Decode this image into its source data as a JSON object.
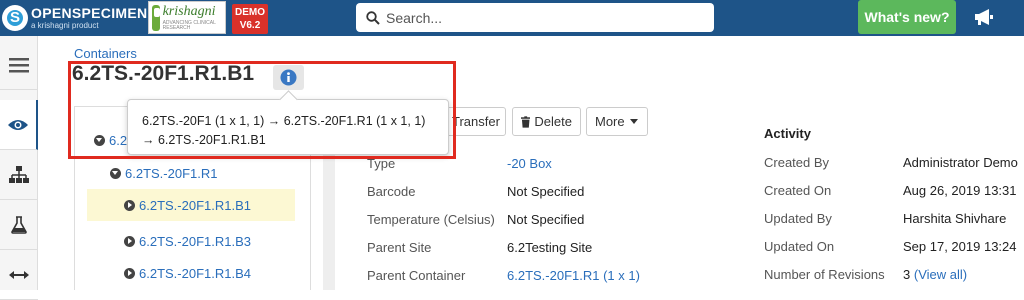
{
  "app": {
    "logo_name": "OPENSPECIMEN",
    "logo_sub": "a krishagni product",
    "brand_name": "krishagni",
    "brand_tag": "ADVANCING CLINICAL RESEARCH",
    "demo_label": "DEMO",
    "version": "V6.2",
    "search_placeholder": "Search...",
    "whats_new": "What's new?"
  },
  "colors": {
    "topbar": "#1e5488",
    "accent_link": "#2a6ebb",
    "whats_new": "#5cb85c",
    "highlight": "#e02a1f",
    "selected_row": "#fcf8d3"
  },
  "rail": {
    "icons": [
      "hamburger-icon",
      "eye-icon",
      "sitemap-icon",
      "flask-icon",
      "transfer-arrows-icon"
    ]
  },
  "breadcrumb": "Containers",
  "page_title": "6.2TS.-20F1.R1.B1",
  "tooltip": {
    "line1": "6.2TS.-20F1 (1 x 1, 1) → 6.2TS.-20F1.R1 (1 x 1, 1)",
    "line2": "→ 6.2TS.-20F1.R1.B1"
  },
  "tree": {
    "root": "6.2TS.-20F1",
    "root_visible": "6.2",
    "rack": "6.2TS.-20F1.R1",
    "boxes": [
      "6.2TS.-20F1.R1.B1",
      "6.2TS.-20F1.R1.B3",
      "6.2TS.-20F1.R1.B4"
    ]
  },
  "toolbar": {
    "transfer": "Transfer",
    "delete": "Delete",
    "more": "More"
  },
  "details": {
    "type_label": "Type",
    "type_value": "-20 Box",
    "barcode_label": "Barcode",
    "barcode_value": "Not Specified",
    "temperature_label": "Temperature (Celsius)",
    "temperature_value": "Not Specified",
    "parent_site_label": "Parent Site",
    "parent_site_value": "6.2Testing Site",
    "parent_container_label": "Parent Container",
    "parent_container_value": "6.2TS.-20F1.R1 (1 x 1)"
  },
  "activity": {
    "heading": "Activity",
    "created_by_label": "Created By",
    "created_by_value": "Administrator Demo",
    "created_on_label": "Created On",
    "created_on_value": "Aug 26, 2019 13:31",
    "updated_by_label": "Updated By",
    "updated_by_value": "Harshita Shivhare",
    "updated_on_label": "Updated On",
    "updated_on_value": "Sep 17, 2019 13:24",
    "revisions_label": "Number of Revisions",
    "revisions_count": "3",
    "revisions_link": "(View all)"
  }
}
